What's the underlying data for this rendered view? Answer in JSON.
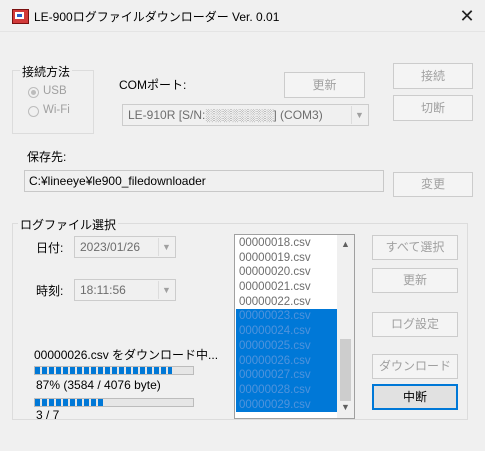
{
  "window": {
    "title": "LE-900ログファイルダウンローダー Ver. 0.01",
    "close_glyph": "✕",
    "accent": "#0078d7"
  },
  "connection": {
    "group_label": "接続方法",
    "radio_usb": "USB",
    "radio_wifi": "Wi-Fi",
    "selected": "USB",
    "com_port_label": "COMポート:",
    "refresh_button": "更新",
    "com_port_value": "LE-910R [S/N:░░░░░░░░] (COM3)",
    "connect_button": "接続",
    "disconnect_button": "切断"
  },
  "save": {
    "label": "保存先:",
    "path": "C:¥lineeye¥le900_filedownloader",
    "change_button": "変更"
  },
  "logfile": {
    "group_label": "ログファイル選択",
    "date_label": "日付:",
    "date_value": "2023/01/26",
    "time_label": "時刻:",
    "time_value": "18:11:56",
    "files": [
      {
        "name": "00000018.csv",
        "selected": false
      },
      {
        "name": "00000019.csv",
        "selected": false
      },
      {
        "name": "00000020.csv",
        "selected": false
      },
      {
        "name": "00000021.csv",
        "selected": false
      },
      {
        "name": "00000022.csv",
        "selected": false
      },
      {
        "name": "00000023.csv",
        "selected": true
      },
      {
        "name": "00000024.csv",
        "selected": true
      },
      {
        "name": "00000025.csv",
        "selected": true
      },
      {
        "name": "00000026.csv",
        "selected": true
      },
      {
        "name": "00000027.csv",
        "selected": true
      },
      {
        "name": "00000028.csv",
        "selected": true
      },
      {
        "name": "00000029.csv",
        "selected": true
      }
    ],
    "select_all_button": "すべて選択",
    "refresh_button": "更新",
    "log_settings_button": "ログ設定",
    "download_button": "ダウンロード",
    "stop_button": "中断"
  },
  "progress": {
    "status_text": "00000026.csv をダウンロード中...",
    "file_progress": 0.87,
    "file_progress_text": "87% (3584 / 4076 byte)",
    "overall_progress": 0.43,
    "overall_progress_text": "3 / 7"
  }
}
